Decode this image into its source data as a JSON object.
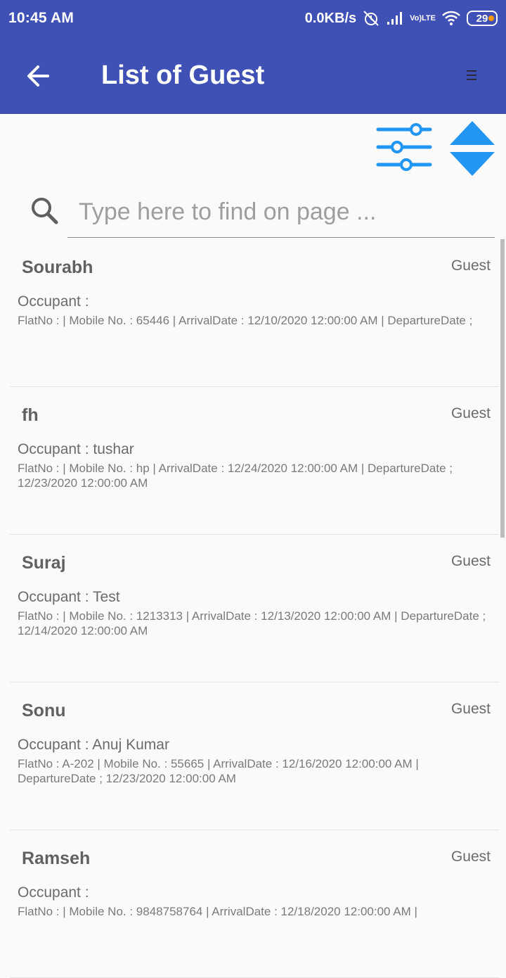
{
  "status_bar": {
    "time": "10:45 AM",
    "speed": "0.0KB/s",
    "network_badge_top": "Vo)",
    "network_badge_bottom": "LTE",
    "battery": "29"
  },
  "app_bar": {
    "title": "List of Guest"
  },
  "search": {
    "placeholder": "Type here to find on page ..."
  },
  "colors": {
    "primary": "#3f51b5",
    "accent_icon": "#2196f3",
    "background": "#fafafa"
  },
  "guests": [
    {
      "name": "Sourabh",
      "type": "Guest",
      "occupant": "Occupant :",
      "details": "FlatNo :  | Mobile No. : 65446 | ArrivalDate : 12/10/2020 12:00:00 AM | DepartureDate ;"
    },
    {
      "name": "fh",
      "type": "Guest",
      "occupant": "Occupant : tushar",
      "details": "FlatNo :  | Mobile No. : hp | ArrivalDate : 12/24/2020 12:00:00 AM | DepartureDate ; 12/23/2020 12:00:00 AM"
    },
    {
      "name": "Suraj",
      "type": "Guest",
      "occupant": "Occupant : Test",
      "details": "FlatNo :  | Mobile No. : 1213313 | ArrivalDate : 12/13/2020 12:00:00 AM | DepartureDate ; 12/14/2020 12:00:00 AM"
    },
    {
      "name": "Sonu",
      "type": "Guest",
      "occupant": "Occupant : Anuj Kumar",
      "details": "FlatNo : A-202 | Mobile No. : 55665 | ArrivalDate : 12/16/2020 12:00:00 AM | DepartureDate ; 12/23/2020 12:00:00 AM"
    },
    {
      "name": "Ramseh",
      "type": "Guest",
      "occupant": "Occupant :",
      "details": "FlatNo :  | Mobile No. : 9848758764 | ArrivalDate : 12/18/2020 12:00:00 AM |"
    }
  ]
}
